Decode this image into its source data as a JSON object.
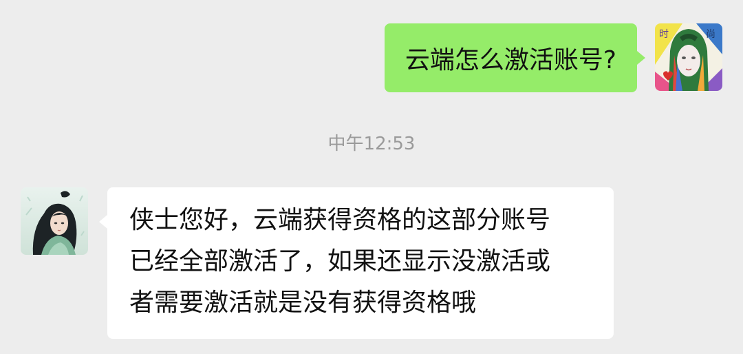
{
  "chat": {
    "outgoing": {
      "text": "云端怎么激活账号?",
      "bubble_color": "#95ec69"
    },
    "timestamp": "中午12:53",
    "incoming": {
      "lines": [
        "侠士您好，云端获得资格的这部分账号",
        "已经全部激活了，如果还显示没激活或",
        "者需要激活就是没有获得资格哦"
      ],
      "bubble_color": "#ffffff"
    },
    "self_avatar": {
      "icon": "painted-portrait-avatar",
      "glyphs": [
        "时",
        "尚"
      ]
    },
    "contact_avatar": {
      "icon": "anime-character-avatar"
    }
  }
}
